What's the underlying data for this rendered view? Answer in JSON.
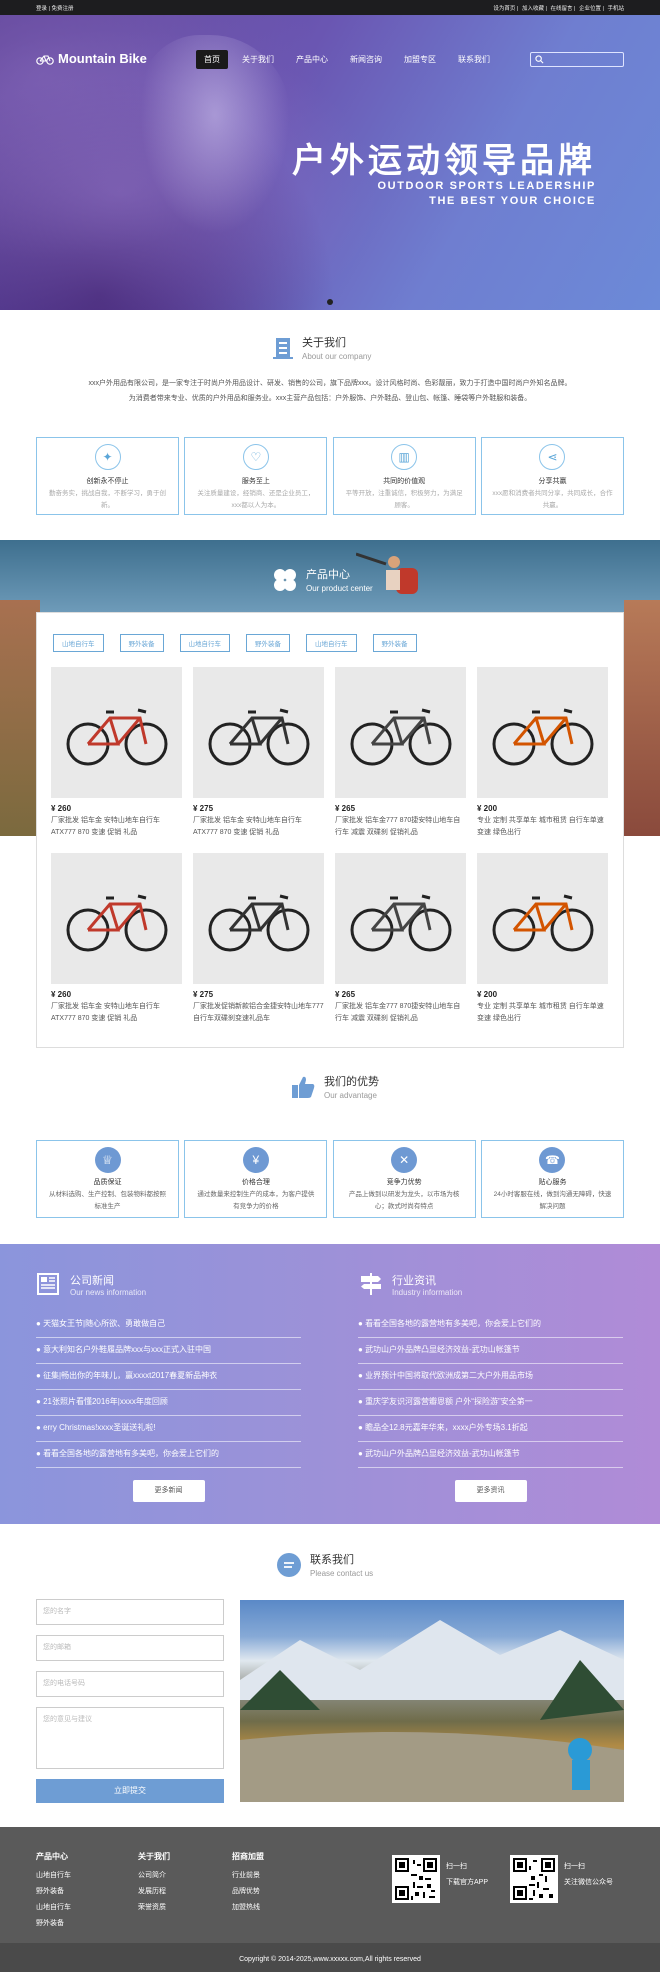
{
  "topbar": {
    "left": "登录 | 免费注册",
    "links": [
      "设为首页",
      "加入收藏",
      "在线留言",
      "企业位置",
      "手机站"
    ]
  },
  "header": {
    "logo": "Mountain Bike",
    "nav": [
      "首页",
      "关于我们",
      "产品中心",
      "新闻咨询",
      "加盟专区",
      "联系我们"
    ],
    "search_placeholder": ""
  },
  "hero": {
    "title": "户外运动领导品牌",
    "subtitle1": "OUTDOOR SPORTS LEADERSHIP",
    "subtitle2": "THE BEST YOUR CHOICE"
  },
  "about": {
    "title": "关于我们",
    "subtitle": "About our company",
    "text1": "xxx户外用品有限公司，是一家专注于时尚户外用品设计、研发、销售的公司，旗下品牌xxx。设计风格时尚、色彩靓丽，致力于打造中国时尚户外知名品牌。",
    "text2": "为消费者带来专业、优质的户外用品和服务业。xxx主营产品包括：户外服饰、户外鞋品、登山包、帐篷、睡袋等户外鞋服和装备。",
    "cards": [
      {
        "title": "创新永不停止",
        "desc": "勤奋务实，挑战自我，不断学习，勇于创新。"
      },
      {
        "title": "服务至上",
        "desc": "关注质量建设，经销商、还是企业员工，xxx都以人为本。"
      },
      {
        "title": "共同的价值观",
        "desc": "平等开放，注重诚信，积极努力，为满足顾客。"
      },
      {
        "title": "分享共赢",
        "desc": "xxx愿和消费者共同分享，共同成长，合作共赢。"
      }
    ]
  },
  "products": {
    "title": "产品中心",
    "subtitle": "Our product center",
    "tags": [
      "山地自行车",
      "野外装备",
      "山地自行车",
      "野外装备",
      "山地自行车",
      "野外装备"
    ],
    "items": [
      {
        "price": "¥ 260",
        "desc": "厂家批发 铝车金 安特山地车自行车ATX777 870 变速 促销 礼品"
      },
      {
        "price": "¥ 275",
        "desc": "厂家批发 铝车金 安特山地车自行车ATX777 870 变速 促销 礼品"
      },
      {
        "price": "¥ 265",
        "desc": "厂家批发 铝车金777 870捷安特山地车自行车 减震 双碟刹 促销礼品"
      },
      {
        "price": "¥ 200",
        "desc": "专业 定制 共享单车 城市租赁 自行车单速 变速 绿色出行"
      },
      {
        "price": "¥ 260",
        "desc": "厂家批发 铝车金 安特山地车自行车ATX777 870 变速 促销 礼品"
      },
      {
        "price": "¥ 275",
        "desc": "厂家批发促销新款铝合金捷安特山地车777自行车双碟刹变速礼品车"
      },
      {
        "price": "¥ 265",
        "desc": "厂家批发 铝车金777 870捷安特山地车自行车 减震 双碟刹 促销礼品"
      },
      {
        "price": "¥ 200",
        "desc": "专业 定制 共享单车 城市租赁 自行车单速 变速 绿色出行"
      }
    ]
  },
  "advantage": {
    "title": "我们的优势",
    "subtitle": "Our advantage",
    "cards": [
      {
        "title": "品质保证",
        "desc": "从材料选购、生产控制、包装物料都按照标准生产"
      },
      {
        "title": "价格合理",
        "desc": "通过数量来控制生产的成本，为客户提供有竞争力的价格"
      },
      {
        "title": "竞争力优势",
        "desc": "产品上做到以研发为龙头，以市场为核心；款式时尚有特点"
      },
      {
        "title": "贴心服务",
        "desc": "24小时客服在线，做到沟通无障碍，快速解决问题"
      }
    ]
  },
  "news": {
    "company": {
      "title": "公司新闻",
      "subtitle": "Our news information",
      "items": [
        "天猫女王节|随心所欲、勇敢做自己",
        "意大利知名户外鞋履品牌xxx与xxx正式入驻中国",
        "征集|畅出你的年味儿，赢xxxxt2017春夏新品神衣",
        "21张照片看懂2016年|xxxx年度回顾",
        "erry Christmas!xxxx圣诞送礼啦!",
        "看看全国各地的露营地有多美吧，你会爱上它们的"
      ],
      "more": "更多新闻"
    },
    "industry": {
      "title": "行业资讯",
      "subtitle": "Industry information",
      "items": [
        "看看全国各地的露营地有多美吧，你会爱上它们的",
        "武功山户外品牌凸显经济效益-武功山帐篷节",
        "业界预计中国将取代欧洲成第二大户外用品市场",
        "重庆学友识河露营瓣恩额 户外“探险游”安全第一",
        "瞻品全12.8元嘉年华来，xxxx户外专场3.1折起",
        "武功山户外品牌凸显经济效益-武功山帐篷节"
      ],
      "more": "更多资讯"
    }
  },
  "contact": {
    "title": "联系我们",
    "subtitle": "Please contact us",
    "name_placeholder": "您的名字",
    "email_placeholder": "您的邮箱",
    "phone_placeholder": "您的电话号码",
    "msg_placeholder": "您的意见与建议",
    "submit": "立即提交"
  },
  "footer": {
    "cols": [
      {
        "title": "产品中心",
        "items": [
          "山地自行车",
          "野外装备",
          "山地自行车",
          "野外装备"
        ]
      },
      {
        "title": "关于我们",
        "items": [
          "公司简介",
          "发展历程",
          "荣誉资质"
        ]
      },
      {
        "title": "招商加盟",
        "items": [
          "行业前景",
          "品牌优势",
          "加盟热线"
        ]
      }
    ],
    "qr1": {
      "line1": "扫一扫",
      "line2": "下载官方APP"
    },
    "qr2": {
      "line1": "扫一扫",
      "line2": "关注微信公众号"
    },
    "copyright": "Copyright © 2014-2025,www.xxxxx.com,All rights reserved"
  },
  "colors": {
    "accent": "#6e9dd4",
    "border": "#8bc4ea",
    "footer": "#5a5a5a"
  }
}
